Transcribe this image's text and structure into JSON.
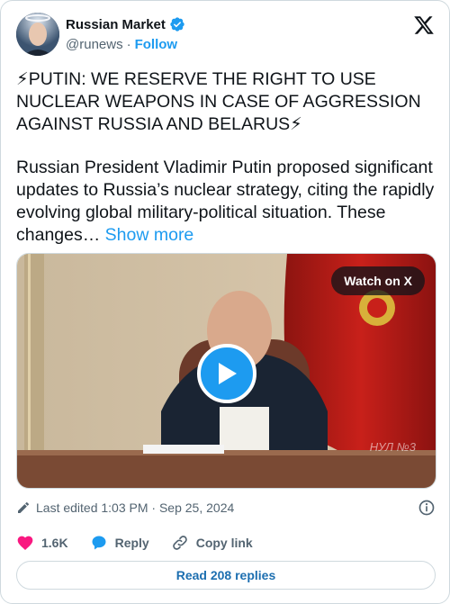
{
  "author": {
    "name": "Russian Market",
    "handle": "@runews",
    "separator": "·",
    "follow_label": "Follow"
  },
  "tweet": {
    "headline": "⚡PUTIN: WE RESERVE THE RIGHT TO USE NUCLEAR WEAPONS IN CASE OF AGGRESSION AGAINST RUSSIA AND BELARUS⚡",
    "body": "Russian President Vladimir Putin proposed significant updates to Russia’s nuclear strategy, citing the rapidly evolving global military-political situation. These changes…",
    "show_more": "Show more"
  },
  "media": {
    "watch_label": "Watch on X",
    "watermark": "НУЛ №3"
  },
  "meta": {
    "edited": "Last edited 1:03 PM · Sep 25, 2024"
  },
  "actions": {
    "likes": "1.6K",
    "reply": "Reply",
    "copy_link": "Copy link"
  },
  "replies_button": "Read 208 replies",
  "colors": {
    "accent": "#1d9bf0",
    "heart": "#f91880",
    "muted": "#536471"
  }
}
